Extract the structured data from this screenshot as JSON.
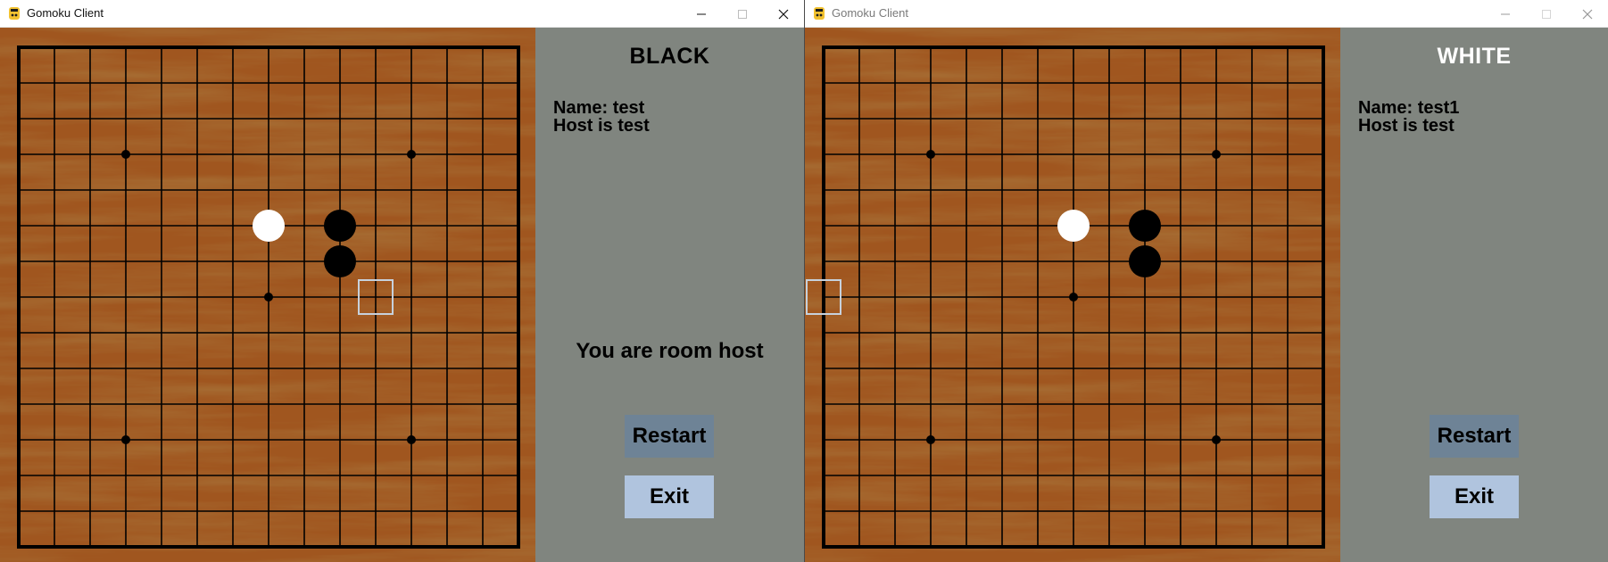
{
  "colors": {
    "panel_bg": "#80857f",
    "board_wood": "#a0561f",
    "grid_line": "#000000",
    "restart_bg": "#6e8396",
    "exit_bg": "#b0c4de",
    "hover_square": "#c7d1dc",
    "white_title": "#ffffff",
    "black_title": "#000000"
  },
  "board": {
    "size": 15,
    "star_points": [
      [
        3,
        3
      ],
      [
        11,
        3
      ],
      [
        7,
        7
      ],
      [
        3,
        11
      ],
      [
        11,
        11
      ]
    ],
    "stones": [
      {
        "col": 7,
        "row": 5,
        "color": "white"
      },
      {
        "col": 9,
        "row": 5,
        "color": "black"
      },
      {
        "col": 9,
        "row": 6,
        "color": "black"
      }
    ]
  },
  "windows": [
    {
      "title": "Gomoku Client",
      "icon": "python-snake-icon",
      "active": true,
      "controls": {
        "minimize": "minimize-icon",
        "maximize": "maximize-icon",
        "close": "close-icon"
      },
      "hover_cell": {
        "col": 10,
        "row": 7
      },
      "panel": {
        "role": "BLACK",
        "name_line": "Name: test",
        "host_line": "Host is test",
        "host_message": "You are room host",
        "restart_label": "Restart",
        "exit_label": "Exit"
      }
    },
    {
      "title": "Gomoku Client",
      "icon": "python-snake-icon",
      "active": false,
      "controls": {
        "minimize": "minimize-icon",
        "maximize": "maximize-icon",
        "close": "close-icon"
      },
      "hover_cell": {
        "col": 0,
        "row": 7
      },
      "panel": {
        "role": "WHITE",
        "name_line": "Name: test1",
        "host_line": "Host is test",
        "host_message": "",
        "restart_label": "Restart",
        "exit_label": "Exit"
      }
    }
  ]
}
